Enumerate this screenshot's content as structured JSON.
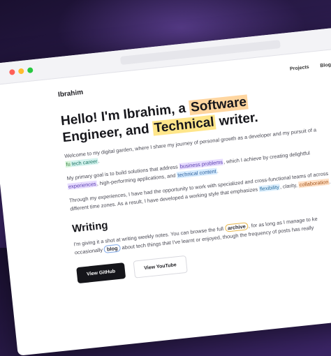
{
  "nav": {
    "brand": "Ibrahim",
    "links": [
      "Projects",
      "Blog"
    ]
  },
  "hero": {
    "title_part1": "Hello! I'm Ibrahim, a ",
    "title_hl1": "Software",
    "title_part2": " Engineer, and ",
    "title_hl2": "Technical",
    "title_part3": " writer."
  },
  "intro": {
    "p1_a": "Welcome to my digital garden, where I share my journey of personal growth as a developer and my pursuit of a ",
    "p1_hl": "fu",
    "p1_b": "",
    "p1_hl2": "tech career",
    "p1_c": ".",
    "p2_a": "My primary goal is to build solutions that address ",
    "p2_hl1": "business problems",
    "p2_b": ", which I achieve by creating delightful ",
    "p2_hl2": "experiences",
    "p2_c": ", high-performing applications, and ",
    "p2_hl3": "technical content",
    "p2_d": ".",
    "p3_a": "Through my experiences, I have had the opportunity to work with specialized and cross-functional teams of ",
    "p3_b": "across different time zones. As a result, I have developed a working style that emphasizes ",
    "p3_hl1": "flexibility",
    "p3_c": ", clarity, ",
    "p3_hl2": "collaboration",
    "p3_d": "."
  },
  "writing": {
    "heading": "Writing",
    "text_a": "I'm giving it a shot at writing weekly notes. You can browse the full ",
    "archive": "archive",
    "text_b": ", for as long as I manage to ke",
    "text_c": "occasionally ",
    "blog": "blog",
    "text_d": " about tech things that I've learnt or enjoyed, though the frequency of posts has really"
  },
  "buttons": {
    "github": "View GitHub",
    "youtube": "View YouTube"
  },
  "colors": {
    "background": "#2a1b4a",
    "highlight_yellow": "#ffe68a",
    "highlight_orange": "#ffd6a0"
  }
}
